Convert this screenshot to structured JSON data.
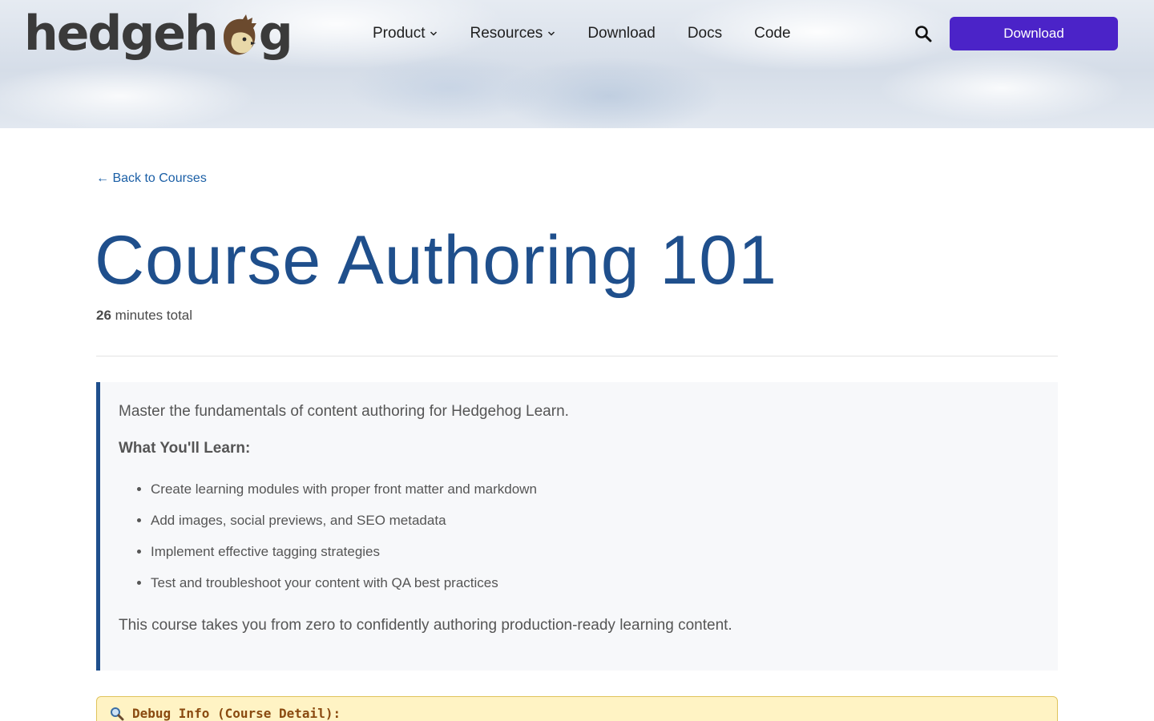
{
  "header": {
    "logo_text_left": "hedgeh",
    "logo_text_right": "g",
    "nav": [
      {
        "label": "Product",
        "has_dropdown": true
      },
      {
        "label": "Resources",
        "has_dropdown": true
      },
      {
        "label": "Download",
        "has_dropdown": false
      },
      {
        "label": "Docs",
        "has_dropdown": false
      },
      {
        "label": "Code",
        "has_dropdown": false
      }
    ],
    "search_icon": "search-icon",
    "cta_label": "Download",
    "cta_color": "#4b23c8"
  },
  "main": {
    "back_link": "← Back to Courses",
    "title": "Course Authoring 101",
    "duration_value": "26",
    "duration_label": "minutes total",
    "summary": {
      "intro": "Master the fundamentals of content authoring for Hedgehog Learn.",
      "learn_heading": "What You'll Learn:",
      "items": [
        "Create learning modules with proper front matter and markdown",
        "Add images, social previews, and SEO metadata",
        "Implement effective tagging strategies",
        "Test and troubleshoot your content with QA best practices"
      ],
      "outro": "This course takes you from zero to confidently authoring production-ready learning content."
    },
    "debug": {
      "icon": "magnifier-icon",
      "title": "Debug Info (Course Detail):"
    }
  },
  "colors": {
    "title": "#1f4f8c",
    "link": "#1b5fa6",
    "accent_bar": "#1f4f8c",
    "debug_bg": "#fff3c4"
  }
}
